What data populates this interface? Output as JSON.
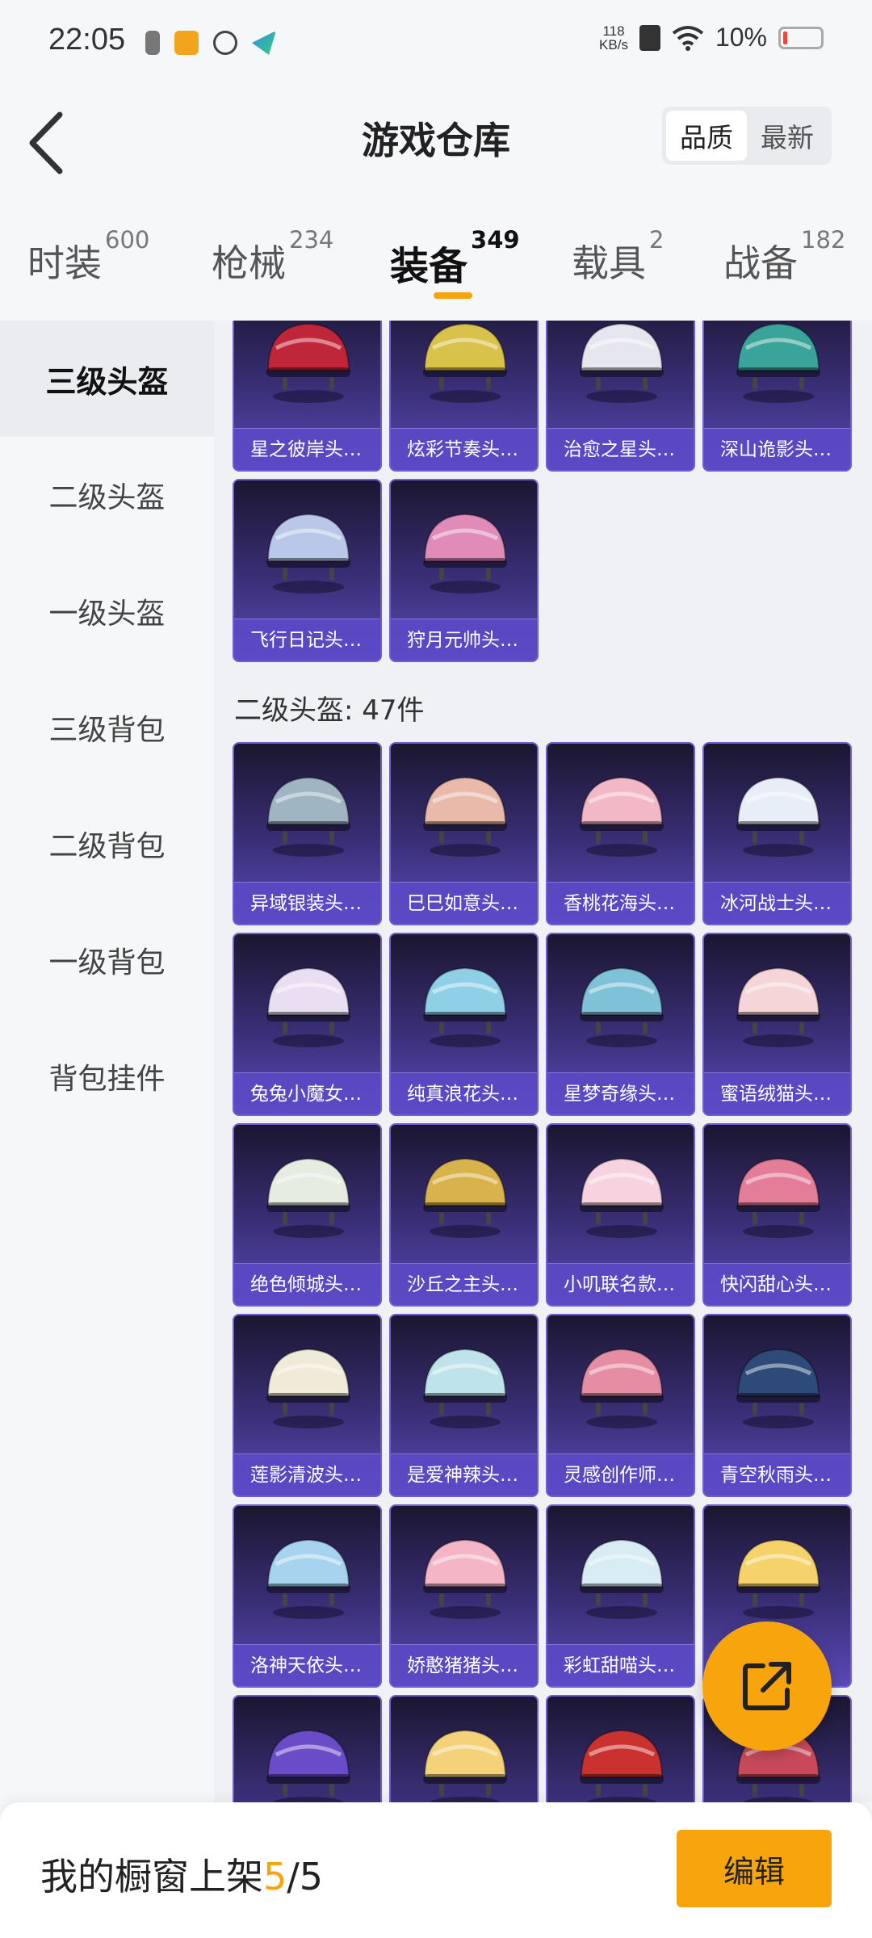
{
  "status_bar": {
    "time": "22:05",
    "net_speed_value": "118",
    "net_speed_unit": "KB/s",
    "battery": "10%"
  },
  "header": {
    "title": "游戏仓库",
    "sort_quality": "品质",
    "sort_newest": "最新"
  },
  "tabs": [
    {
      "label": "时装",
      "count": "600"
    },
    {
      "label": "枪械",
      "count": "234"
    },
    {
      "label": "装备",
      "count": "349"
    },
    {
      "label": "载具",
      "count": "2"
    },
    {
      "label": "战备",
      "count": "182"
    }
  ],
  "sidebar": {
    "items": [
      "三级头盔",
      "二级头盔",
      "一级头盔",
      "三级背包",
      "二级背包",
      "一级背包",
      "背包挂件"
    ]
  },
  "section_level3": {
    "items": [
      {
        "name": "星之彼岸头…",
        "color": "#c0263a"
      },
      {
        "name": "炫彩节奏头…",
        "color": "#d9c24a"
      },
      {
        "name": "治愈之星头…",
        "color": "#e6e6ee"
      },
      {
        "name": "深山诡影头…",
        "color": "#3aa39a"
      },
      {
        "name": "飞行日记头…",
        "color": "#b9c7e8"
      },
      {
        "name": "狩月元帅头…",
        "color": "#e08bb8"
      }
    ]
  },
  "section_level2": {
    "title": "二级头盔: 47件",
    "items": [
      {
        "name": "异域银装头…",
        "color": "#9fb5c2"
      },
      {
        "name": "巳巳如意头…",
        "color": "#e9b9a9"
      },
      {
        "name": "香桃花海头…",
        "color": "#f2b8c6"
      },
      {
        "name": "冰河战士头…",
        "color": "#e8eef7"
      },
      {
        "name": "兔兔小魔女…",
        "color": "#eadff2"
      },
      {
        "name": "纯真浪花头…",
        "color": "#8fd0e6"
      },
      {
        "name": "星梦奇缘头…",
        "color": "#7fc2d8"
      },
      {
        "name": "蜜语绒猫头…",
        "color": "#f5d5d8"
      },
      {
        "name": "绝色倾城头…",
        "color": "#e6ece0"
      },
      {
        "name": "沙丘之主头…",
        "color": "#d8b24a"
      },
      {
        "name": "小叽联名款…",
        "color": "#f7d3df"
      },
      {
        "name": "快闪甜心头…",
        "color": "#e37d98"
      },
      {
        "name": "莲影清波头…",
        "color": "#f0ead8"
      },
      {
        "name": "是爱神辣头…",
        "color": "#bfe3ea"
      },
      {
        "name": "灵感创作师…",
        "color": "#e58da3"
      },
      {
        "name": "青空秋雨头…",
        "color": "#2e4a78"
      },
      {
        "name": "洛神天依头…",
        "color": "#a7d3ee"
      },
      {
        "name": "娇憨猪猪头…",
        "color": "#f4b6c6"
      },
      {
        "name": "彩虹甜喵头…",
        "color": "#d7ecf3"
      },
      {
        "name": "",
        "color": "#f6d36a"
      },
      {
        "name": "",
        "color": "#6a4cc9"
      },
      {
        "name": "",
        "color": "#f3d27a"
      },
      {
        "name": "",
        "color": "#c9322e"
      },
      {
        "name": "",
        "color": "#c84a5a"
      }
    ]
  },
  "bottom_bar": {
    "label": "我的橱窗上架",
    "current": "5",
    "separator": "/",
    "total": "5",
    "edit_label": "编辑"
  }
}
